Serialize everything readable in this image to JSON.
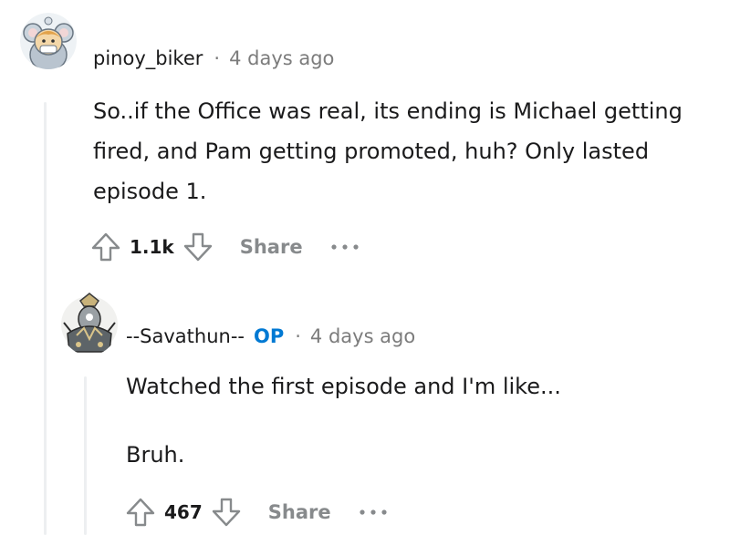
{
  "comment1": {
    "username": "pinoy_biker",
    "separator": "·",
    "time": "4 days ago",
    "body": "So..if the Office was real, its ending is Michael getting fired, and Pam getting promoted, huh? Only lasted episode 1.",
    "score": "1.1k",
    "share_label": "Share",
    "avatar_icon": "koala-avatar-icon"
  },
  "comment2": {
    "username": "--Savathun--",
    "op_badge": "OP",
    "separator": "·",
    "time": "4 days ago",
    "body_line1": "Watched the first episode and I'm like...",
    "body_line2": "Bruh.",
    "score": "467",
    "share_label": "Share",
    "avatar_icon": "armored-character-avatar-icon"
  },
  "colors": {
    "op_blue": "#0079d3",
    "meta_gray": "#7c7c7c",
    "share_gray": "#878a8c",
    "thread_line": "#edeff1"
  }
}
